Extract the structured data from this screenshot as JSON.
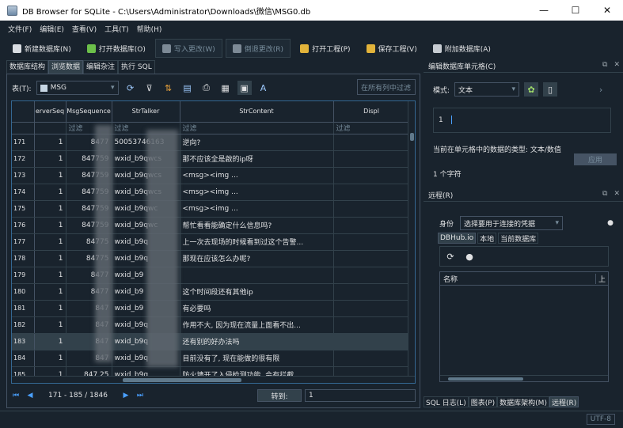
{
  "window": {
    "title": "DB Browser for SQLite - C:\\Users\\Administrator\\Downloads\\微信\\MSG0.db",
    "minimize": "—",
    "maximize": "☐",
    "close": "✕"
  },
  "menu": [
    "文件(F)",
    "编辑(E)",
    "查看(V)",
    "工具(T)",
    "帮助(H)"
  ],
  "toolbar": {
    "new_db": "新建数据库(N)",
    "open_db": "打开数据库(O)",
    "write_changes": "写入更改(W)",
    "revert_changes": "倒退更改(R)",
    "open_project": "打开工程(P)",
    "save_project": "保存工程(V)",
    "attach_db": "附加数据库(A)"
  },
  "tabs": [
    "数据库结构",
    "浏览数据",
    "编辑杂注",
    "执行 SQL"
  ],
  "active_tab": 1,
  "table_selector": {
    "label": "表(T):",
    "value": "MSG"
  },
  "filter_all_placeholder": "在所有列中过滤",
  "grid": {
    "columns": [
      "erverSeq",
      "MsgSequence",
      "StrTalker",
      "StrContent",
      "Displ"
    ],
    "filter_placeholder": "过滤",
    "rows": [
      {
        "n": "171",
        "seq": "1",
        "msgseq": "8477",
        "talker": "50053746163",
        "content": "逆向?"
      },
      {
        "n": "172",
        "seq": "1",
        "msgseq": "847759",
        "talker": "wxid_b9qwcs",
        "content": "那不应该全是啟的ip呀"
      },
      {
        "n": "173",
        "seq": "1",
        "msgseq": "847759",
        "talker": "wxid_b9qwcs",
        "content": "<msg><img ..."
      },
      {
        "n": "174",
        "seq": "1",
        "msgseq": "847759",
        "talker": "wxid_b9qwcs",
        "content": "<msg><img ..."
      },
      {
        "n": "175",
        "seq": "1",
        "msgseq": "847759",
        "talker": "wxid_b9qwc",
        "content": "<msg><img ..."
      },
      {
        "n": "176",
        "seq": "1",
        "msgseq": "847759",
        "talker": "wxid_b9qwc",
        "content": "帮忙看看能确定什么信息吗?"
      },
      {
        "n": "177",
        "seq": "1",
        "msgseq": "84775",
        "talker": "wxid_b9q",
        "content": "上一次去现场的时候看到过这个告警..."
      },
      {
        "n": "178",
        "seq": "1",
        "msgseq": "84775",
        "talker": "wxid_b9q",
        "content": "那现在应该怎么办呢?"
      },
      {
        "n": "179",
        "seq": "1",
        "msgseq": "8477",
        "talker": "wxid_b9",
        "content": ""
      },
      {
        "n": "180",
        "seq": "1",
        "msgseq": "8477",
        "talker": "wxid_b9",
        "content": "这个时间段还有其他ip"
      },
      {
        "n": "181",
        "seq": "1",
        "msgseq": "847",
        "talker": "wxid_b9",
        "content": "有必要吗"
      },
      {
        "n": "182",
        "seq": "1",
        "msgseq": "847",
        "talker": "wxid_b9q",
        "content": "作用不大, 因为现在流量上面看不出..."
      },
      {
        "n": "183",
        "seq": "1",
        "msgseq": "847",
        "talker": "wxid_b9q",
        "content": "还有别的好办法吗"
      },
      {
        "n": "184",
        "seq": "1",
        "msgseq": "847",
        "talker": "wxid_b9q",
        "content": "目前没有了, 现在能做的很有限"
      },
      {
        "n": "185",
        "seq": "1",
        "msgseq": "847  25",
        "talker": "wxid_b9q",
        "content": "防火墙开了入侵检测功能, 会有拦截..."
      }
    ],
    "selected_row": 12
  },
  "navigation": {
    "range": "171 - 185 / 1846",
    "goto_label": "转到:",
    "goto_value": "1"
  },
  "edit_cell": {
    "title": "编辑数据库单元格(C)",
    "mode_label": "模式:",
    "mode_value": "文本",
    "cell_value": "1",
    "type_info": "当前在单元格中的数据的类型: 文本/数值",
    "char_count": "1 个字符",
    "apply": "应用"
  },
  "remote": {
    "title": "远程(R)",
    "identity_label": "身份",
    "identity_value": "选择要用于连接的凭据",
    "tabs": [
      "DBHub.io",
      "本地",
      "当前数据库"
    ],
    "list_header": "名称",
    "list_header2": "上"
  },
  "bottom_tabs": [
    "SQL 日志(L)",
    "图表(P)",
    "数据库架构(M)",
    "远程(R)"
  ],
  "encoding": "UTF-8",
  "colors": {
    "accent": "#346792",
    "bg": "#19232d",
    "panel": "#32414b",
    "link": "#4aa0ff"
  }
}
